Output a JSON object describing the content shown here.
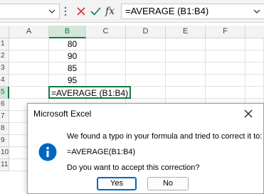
{
  "formula_bar": {
    "name_box_arrow_icon": "chevron-down-icon",
    "cancel_icon": "close-icon",
    "enter_icon": "checkmark-icon",
    "fx_label": "fx",
    "formula": "=AVERAGE (B1:B4)",
    "expand_icon": "chevron-down-icon",
    "cancel_color": "#d13438",
    "enter_color": "#107c41"
  },
  "sheet": {
    "columns": [
      "A",
      "B",
      "C",
      "D",
      "E",
      "F"
    ],
    "selected_column": "B",
    "rows": [
      "1",
      "2",
      "3",
      "4",
      "5",
      "6",
      "7",
      "8",
      "9",
      "10",
      "11"
    ],
    "selected_row": "5",
    "values": {
      "B1": "80",
      "B2": "90",
      "B3": "85",
      "B4": "95"
    },
    "editing_cell": "B5",
    "editing_text": "=AVERAGE (B1:B4)",
    "accent": "#107c41"
  },
  "dialog": {
    "title": "Microsoft Excel",
    "close_icon": "close-icon",
    "info_icon": "info-icon",
    "message": "We found a typo in your formula and tried to correct it to:",
    "corrected_formula": "=AVERAGE(B1:B4)",
    "question": "Do you want to accept this correction?",
    "yes_label": "Yes",
    "no_label": "No",
    "icon_color": "#0067c0"
  }
}
